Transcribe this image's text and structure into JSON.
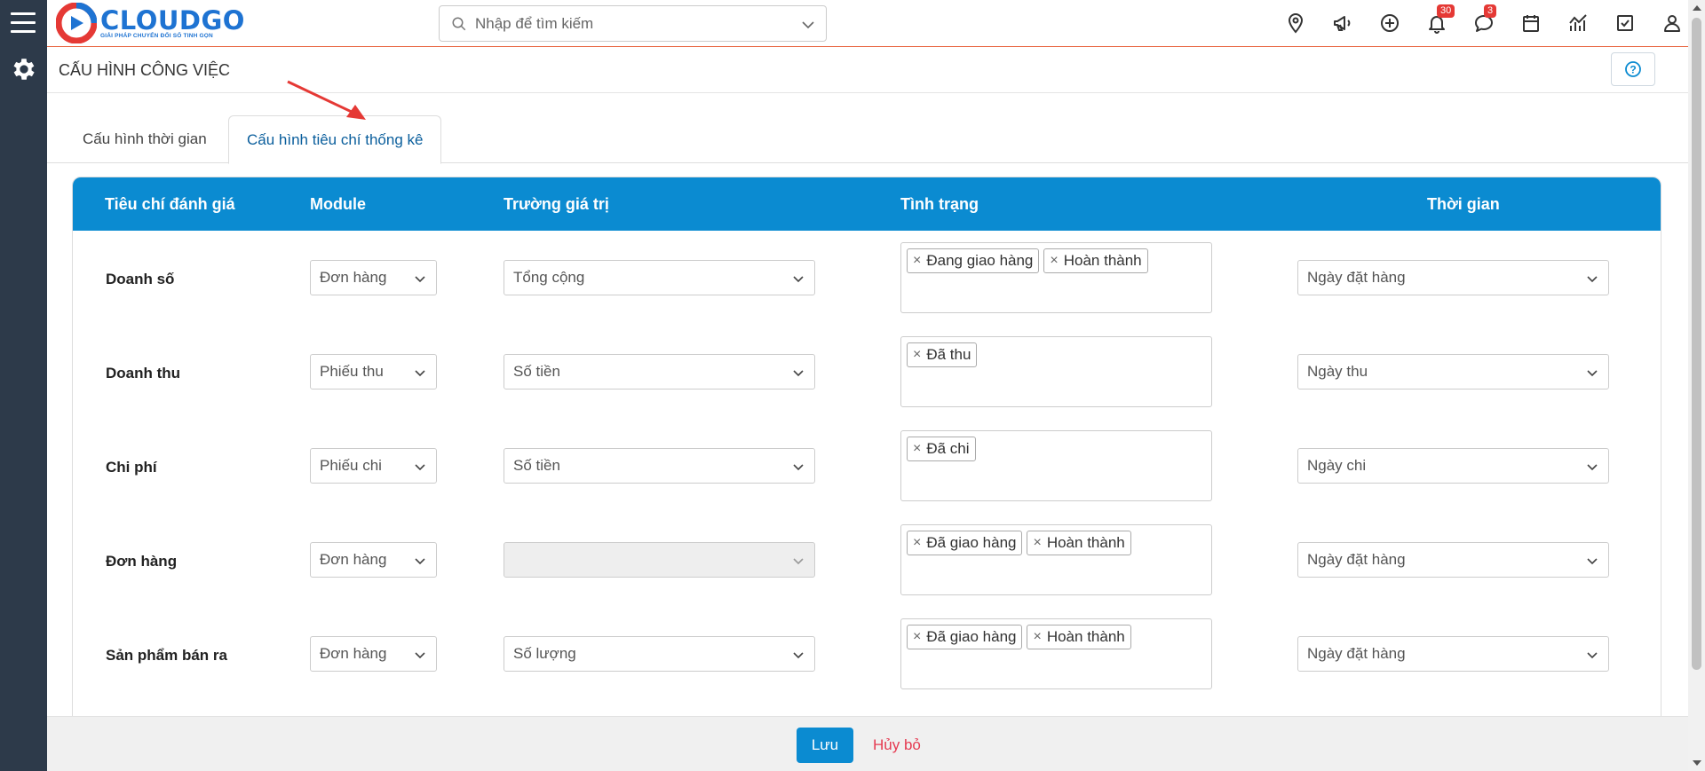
{
  "app": {
    "brand": "CLOUDGO",
    "tagline": "GIẢI PHÁP CHUYỂN ĐỔI SỐ TINH GỌN"
  },
  "search": {
    "placeholder": "Nhập để tìm kiếm"
  },
  "topbar": {
    "icons": [
      "location-pin-icon",
      "megaphone-icon",
      "plus-circle-icon",
      "bell-icon",
      "chat-icon",
      "calendar-icon",
      "chart-icon",
      "checkbox-icon",
      "user-icon",
      "gear-icon"
    ],
    "notifications_count": "30",
    "messages_count": "3"
  },
  "page": {
    "title": "CẤU HÌNH CÔNG VIỆC"
  },
  "tabs": [
    {
      "label": "Cấu hình thời gian",
      "active": false
    },
    {
      "label": "Cấu hình tiêu chí thống kê",
      "active": true
    }
  ],
  "table": {
    "headers": {
      "criteria": "Tiêu chí đánh giá",
      "module": "Module",
      "value_field": "Trường giá trị",
      "status": "Tình trạng",
      "time": "Thời gian"
    },
    "rows": [
      {
        "criteria": "Doanh số",
        "module": "Đơn hàng",
        "value_field": "Tổng cộng",
        "status_tags": [
          "Đang giao hàng",
          "Hoàn thành"
        ],
        "time": "Ngày đặt hàng"
      },
      {
        "criteria": "Doanh thu",
        "module": "Phiếu thu",
        "value_field": "Số tiền",
        "status_tags": [
          "Đã thu"
        ],
        "time": "Ngày thu"
      },
      {
        "criteria": "Chi phí",
        "module": "Phiếu chi",
        "value_field": "Số tiền",
        "status_tags": [
          "Đã chi"
        ],
        "time": "Ngày chi"
      },
      {
        "criteria": "Đơn hàng",
        "module": "Đơn hàng",
        "value_field": "",
        "status_tags": [
          "Đã giao hàng",
          "Hoàn thành"
        ],
        "time": "Ngày đặt hàng"
      },
      {
        "criteria": "Sản phẩm bán ra",
        "module": "Đơn hàng",
        "value_field": "Số lượng",
        "status_tags": [
          "Đã giao hàng",
          "Hoàn thành"
        ],
        "time": "Ngày đặt hàng"
      }
    ]
  },
  "footer": {
    "save_label": "Lưu",
    "cancel_label": "Hủy bỏ"
  },
  "colors": {
    "primary": "#0b8bd1",
    "sidebar": "#2d3a4a",
    "brand": "#1e73d2",
    "danger": "#e53950"
  }
}
